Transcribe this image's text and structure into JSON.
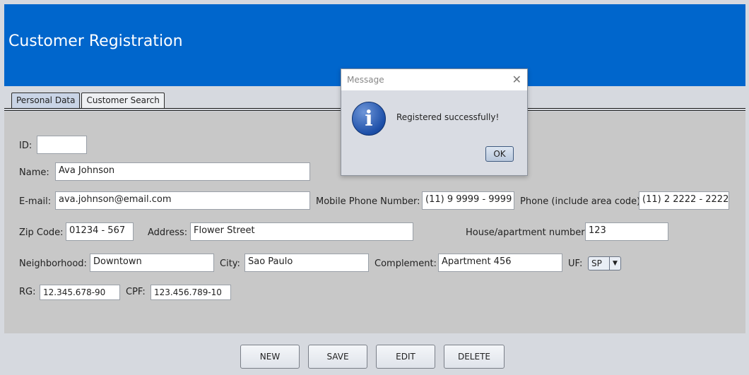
{
  "header": {
    "title": "Customer Registration"
  },
  "tabs": [
    {
      "label": "Personal Data"
    },
    {
      "label": "Customer Search"
    }
  ],
  "form": {
    "id": {
      "label": "ID:",
      "value": ""
    },
    "name": {
      "label": "Name:",
      "value": "Ava Johnson"
    },
    "email": {
      "label": "E-mail:",
      "value": "ava.johnson@email.com"
    },
    "mobile": {
      "label": "Mobile Phone Number:",
      "value": "(11) 9 9999 - 9999"
    },
    "phone": {
      "label": "Phone (include area code):",
      "value": "(11) 2 2222 - 2222"
    },
    "zip": {
      "label": "Zip Code:",
      "value": "01234 - 567"
    },
    "address": {
      "label": "Address:",
      "value": "Flower Street"
    },
    "house": {
      "label": "House/apartment number:",
      "value": "123"
    },
    "neighborhood": {
      "label": "Neighborhood:",
      "value": "Downtown"
    },
    "city": {
      "label": "City:",
      "value": "Sao Paulo"
    },
    "complement": {
      "label": "Complement:",
      "value": "Apartment 456"
    },
    "uf": {
      "label": "UF:",
      "value": "SP"
    },
    "rg": {
      "label": "RG:",
      "value": "12.345.678-90"
    },
    "cpf": {
      "label": "CPF:",
      "value": "123.456.789-10"
    }
  },
  "buttons": {
    "new": "NEW",
    "save": "SAVE",
    "edit": "EDIT",
    "delete": "DELETE"
  },
  "dialog": {
    "title": "Message",
    "close": "✕",
    "icon": "i",
    "message": "Registered successfully!",
    "ok": "OK"
  },
  "colors": {
    "header": "#0066cc",
    "panel": "#c8c8c8",
    "background": "#d6d9df"
  }
}
